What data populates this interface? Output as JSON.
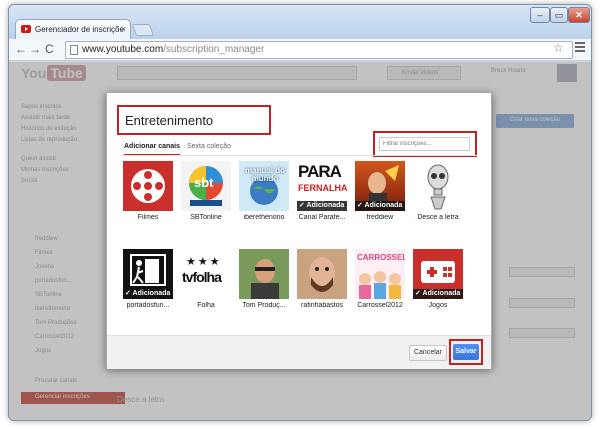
{
  "browser": {
    "tab_title": "Gerenciador de inscriçõe",
    "tab_close": "×",
    "url_host": "www.youtube.com",
    "url_path": "/subscription_manager",
    "back": "←",
    "forward": "→",
    "reload": "C",
    "star": "☆"
  },
  "dialog": {
    "collection_title": "Entretenimento",
    "filter_placeholder": "Filtrar inscrições...",
    "tabs": [
      "Adicionar canais",
      "Sexta coleção"
    ],
    "added_label": "✓ Adicionada",
    "cancel_label": "Cancelar",
    "save_label": "Salvar",
    "channels": [
      {
        "name": "Filmes",
        "added": false
      },
      {
        "name": "SBTonline",
        "added": false
      },
      {
        "name": "iberethenorio",
        "added": false
      },
      {
        "name": "Canal Parafe...",
        "added": true
      },
      {
        "name": "freddiew",
        "added": true
      },
      {
        "name": "Desce a letra",
        "added": false
      },
      {
        "name": "portadosfun...",
        "added": true
      },
      {
        "name": "Folha",
        "added": false
      },
      {
        "name": "Tom Produç...",
        "added": false
      },
      {
        "name": "rafinhabastos",
        "added": false
      },
      {
        "name": "Carrossel2012",
        "added": false
      },
      {
        "name": "Jogos",
        "added": true
      }
    ],
    "thumb_texts": {
      "sbt": "sbt",
      "manual": "manual do mundo",
      "para": "PARA",
      "fernalha": "FERNALHA",
      "folha_stars": "★★★",
      "folha": "tvfolha",
      "carrossel": "CARROSSEL"
    }
  },
  "background": {
    "logo": "You",
    "logo_tube": "Tube",
    "upload": "Enviar vídeos",
    "user": "Brock Hoario",
    "create_collection": "Criar nova coleção",
    "sidebar_top": [
      "Sapos inscritos",
      "Assistir mais tarde",
      "Histórico de exibição",
      "Listas de reprodução",
      "Quem assisti",
      "Minhas inscrições",
      "Social"
    ],
    "sidebar_channels": [
      "freddiew",
      "Filmes",
      "Jovens",
      "portadosfun...",
      "SBTonline",
      "iberethenorio",
      "Tom Produções",
      "Carrossel2012",
      "Jogos"
    ],
    "manage": "Procurar canais",
    "manage_active": "Gerenciar inscrições",
    "behind_row": "Desce a letra"
  }
}
